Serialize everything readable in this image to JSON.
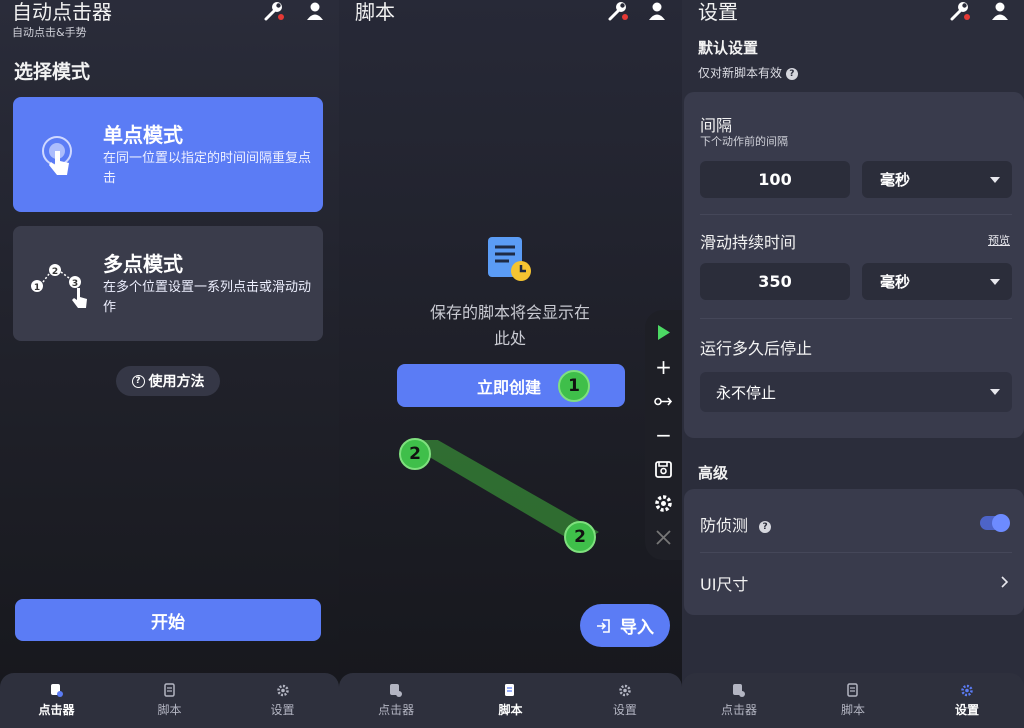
{
  "colors": {
    "accent": "#5b7cf5",
    "marker_green": "#3fbf4a",
    "background": "#1c1d24"
  },
  "tabs": [
    {
      "label": "点击器",
      "icon": "clicker-icon"
    },
    {
      "label": "脚本",
      "icon": "script-icon"
    },
    {
      "label": "设置",
      "icon": "gear-icon"
    }
  ],
  "clicker_page": {
    "title": "自动点击器",
    "subtitle": "自动点击&手势",
    "section_title": "选择模式",
    "single_mode": {
      "title": "单点模式",
      "description": "在同一位置以指定的时间间隔重复点击"
    },
    "multi_mode": {
      "title": "多点模式",
      "description": "在多个位置设置一系列点击或滑动动作"
    },
    "help_label": "使用方法",
    "start_label": "开始"
  },
  "script_page": {
    "title": "脚本",
    "empty_text": "保存的脚本将会显示在此处",
    "create_label": "立即创建",
    "import_label": "导入",
    "markers": [
      "1",
      "2",
      "2"
    ]
  },
  "settings_page": {
    "title": "设置",
    "default_header": "默认设置",
    "default_note": "仅对新脚本有效",
    "interval_label": "间隔",
    "interval_sub": "下个动作前的间隔",
    "interval_value": "100",
    "interval_unit": "毫秒",
    "swipe_label": "滑动持续时间",
    "preview_label": "预览",
    "swipe_value": "350",
    "swipe_unit": "毫秒",
    "stop_label": "运行多久后停止",
    "stop_value": "永不停止",
    "advanced_header": "高级",
    "anti_detect_label": "防侦测",
    "anti_detect_on": true,
    "ui_size_label": "UI尺寸"
  }
}
